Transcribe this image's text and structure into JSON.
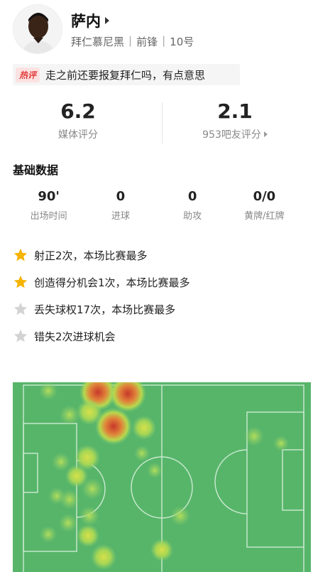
{
  "player": {
    "name": "萨内",
    "club": "拜仁慕尼黑",
    "position": "前锋",
    "number": "10号"
  },
  "hot_comment": {
    "badge": "热评",
    "text": "走之前还要报复拜仁吗，有点意思"
  },
  "ratings": {
    "media_value": "6.2",
    "media_label": "媒体评分",
    "fans_value": "2.1",
    "fans_label": "953吧友评分"
  },
  "basic": {
    "title": "基础数据",
    "stats": [
      {
        "value": "90'",
        "label": "出场时间"
      },
      {
        "value": "0",
        "label": "进球"
      },
      {
        "value": "0",
        "label": "助攻"
      },
      {
        "value": "0/0",
        "label": "黄牌/红牌"
      }
    ]
  },
  "highlights": [
    {
      "text": "射正2次，本场比赛最多",
      "icon": "star-gold-icon",
      "color": "#f5b400"
    },
    {
      "text": "创造得分机会1次，本场比赛最多",
      "icon": "star-gold-icon",
      "color": "#f5b400"
    },
    {
      "text": "丢失球权17次，本场比赛最多",
      "icon": "star-gray-icon",
      "color": "#d0d0d0"
    },
    {
      "text": "错失2次进球机会",
      "icon": "star-gray-icon",
      "color": "#d0d0d0"
    }
  ],
  "colors": {
    "pitch": "#57b56a",
    "heat_hot": "#d9432a",
    "heat_warm": "#9bd14a",
    "badge": "#e23b3b"
  }
}
